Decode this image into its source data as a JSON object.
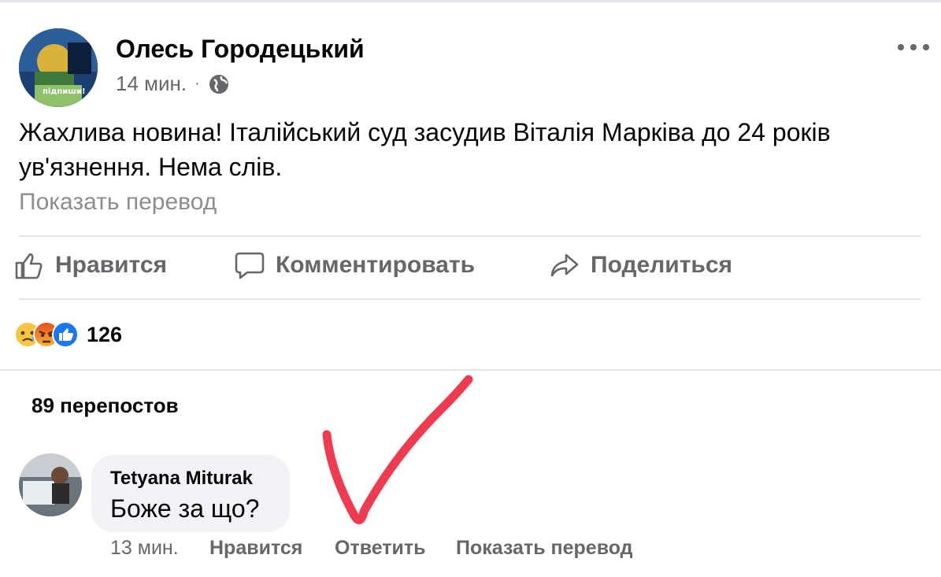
{
  "post": {
    "author": "Олесь Городецький",
    "time": "14 мин.",
    "separator": "·",
    "privacy_icon": "globe-icon",
    "text": "Жахлива новина! Італійський суд засудив Віталія Марківа до 24 років ув'язнення. Нема слів.",
    "show_translation": "Показать перевод",
    "avatar_caption": "підпиши!"
  },
  "actions": {
    "like": "Нравится",
    "comment": "Комментировать",
    "share": "Поделиться"
  },
  "reactions": {
    "icons": [
      "sad-reaction-icon",
      "angry-reaction-icon",
      "like-reaction-icon"
    ],
    "count": "126"
  },
  "shares_label": "89 перепостов",
  "comment": {
    "author": "Tetyana Miturak",
    "text": "Боже за що?",
    "time": "13 мин.",
    "like": "Нравится",
    "reply": "Ответить",
    "show_translation": "Показать перевод"
  },
  "colors": {
    "secondary_text": "#65676b",
    "bubble": "#f0f2f5",
    "like_blue": "#1877f2",
    "check_mark": "#ef3a4f"
  }
}
